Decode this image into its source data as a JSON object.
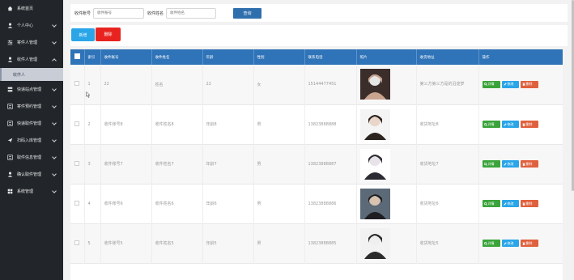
{
  "sidebar": {
    "items": [
      {
        "label": "系统首页",
        "icon": "home-icon",
        "expandable": false
      },
      {
        "label": "个人中心",
        "icon": "user-icon",
        "expandable": true
      },
      {
        "label": "寄件人管理",
        "icon": "sliders-icon",
        "expandable": true
      },
      {
        "label": "收件人管理",
        "icon": "user-icon",
        "expandable": true,
        "open": true
      },
      {
        "label": "快递站点管理",
        "icon": "server-icon",
        "expandable": true
      },
      {
        "label": "寄件预约管理",
        "icon": "list-icon",
        "expandable": true
      },
      {
        "label": "快递取件管理",
        "icon": "list-icon",
        "expandable": true
      },
      {
        "label": "扫码入库管理",
        "icon": "send-icon",
        "expandable": true
      },
      {
        "label": "取件信息管理",
        "icon": "list-icon",
        "expandable": true
      },
      {
        "label": "确认取件管理",
        "icon": "user-icon",
        "expandable": true
      },
      {
        "label": "系统管理",
        "icon": "grid-icon",
        "expandable": true
      }
    ],
    "sub_item": "收件人"
  },
  "search": {
    "field1_label": "收件账号",
    "field1_placeholder": "收件账号",
    "field2_label": "收件姓名",
    "field2_placeholder": "收件姓名",
    "button": "查询"
  },
  "actions": {
    "add": "新增",
    "delete": "删除"
  },
  "table": {
    "headers": [
      "索引",
      "收件账号",
      "收件姓名",
      "年龄",
      "性别",
      "联系电话",
      "照片",
      "收货地址",
      "操作"
    ],
    "rows": [
      {
        "index": "1",
        "account": "22",
        "name": "姓名",
        "age": "22",
        "gender": "女",
        "phone": "15144477451",
        "address": "第三方第三方是的沿途梦"
      },
      {
        "index": "2",
        "account": "收件账号8",
        "name": "收件姓名8",
        "age": "年龄8",
        "gender": "男",
        "phone": "13823888888",
        "address": "收货地址8"
      },
      {
        "index": "3",
        "account": "收件账号7",
        "name": "收件姓名7",
        "age": "年龄7",
        "gender": "男",
        "phone": "13823888887",
        "address": "收货地址7"
      },
      {
        "index": "4",
        "account": "收件账号6",
        "name": "收件姓名6",
        "age": "年龄6",
        "gender": "男",
        "phone": "13823888886",
        "address": "收货地址6"
      },
      {
        "index": "5",
        "account": "收件账号5",
        "name": "收件姓名5",
        "age": "年龄5",
        "gender": "男",
        "phone": "13823888885",
        "address": "收货地址5"
      }
    ],
    "ops": {
      "detail": "详情",
      "edit": "修改",
      "delete": "删除"
    }
  },
  "colors": {
    "sidebar_bg": "#22262b",
    "header_bg": "#2f73b8",
    "add_btn": "#2aa5e8",
    "delete_btn": "#e8231f",
    "detail_btn": "#3aa43a",
    "edit_btn": "#2aa5e8",
    "row_delete_btn": "#e0603d"
  }
}
